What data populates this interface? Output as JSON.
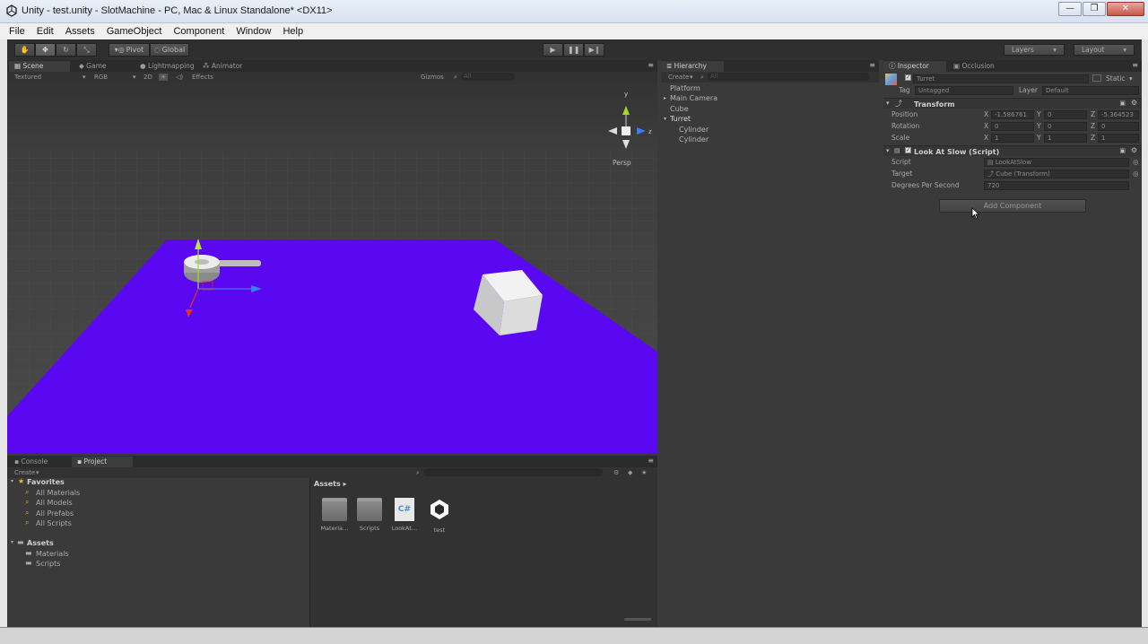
{
  "window": {
    "title": "Unity - test.unity - SlotMachine - PC, Mac & Linux Standalone* <DX11>",
    "controls": [
      "—",
      "❐",
      "✕"
    ]
  },
  "menu": [
    "File",
    "Edit",
    "Assets",
    "GameObject",
    "Component",
    "Window",
    "Help"
  ],
  "toolbar": {
    "pivot": "Pivot",
    "global": "Global",
    "layers": "Layers",
    "layout": "Layout"
  },
  "scene": {
    "tabs": [
      "Scene",
      "Game",
      "Lightmapping",
      "Animator"
    ],
    "shading": "Textured",
    "render_mode": "RGB",
    "mode_2d": "2D",
    "effects": "Effects",
    "gizmos": "Gizmos",
    "search_placeholder": "All",
    "persp_label": "Persp",
    "colors": {
      "floor": "#5b08f2",
      "sky": "#3b3b3b"
    }
  },
  "hierarchy": {
    "tab": "Hierarchy",
    "create": "Create",
    "search_placeholder": "All",
    "items": [
      "Platform",
      "Main Camera",
      "Cube",
      "Turret",
      "Cylinder",
      "Cylinder"
    ]
  },
  "inspector": {
    "tabs": [
      "Inspector",
      "Occlusion"
    ],
    "object_name": "Turret",
    "static_label": "Static",
    "tag_label": "Tag",
    "tag_value": "Untagged",
    "layer_label": "Layer",
    "layer_value": "Default",
    "transform": {
      "title": "Transform",
      "position_label": "Position",
      "rotation_label": "Rotation",
      "scale_label": "Scale",
      "position": {
        "x": "-1.586761",
        "y": "0",
        "z": "-5.364523"
      },
      "rotation": {
        "x": "0",
        "y": "0",
        "z": "0"
      },
      "scale": {
        "x": "1",
        "y": "1",
        "z": "1"
      }
    },
    "script": {
      "title": "Look At Slow (Script)",
      "script_label": "Script",
      "script_value": "LookAtSlow",
      "target_label": "Target",
      "target_value": "Cube (Transform)",
      "dps_label": "Degrees Per Second",
      "dps_value": "720"
    },
    "add_component": "Add Component"
  },
  "project": {
    "tabs": [
      "Console",
      "Project"
    ],
    "create": "Create",
    "favorites_label": "Favorites",
    "favorites": [
      "All Materials",
      "All Models",
      "All Prefabs",
      "All Scripts"
    ],
    "assets_label": "Assets",
    "folders": [
      "Materials",
      "Scripts"
    ],
    "breadcrumb": "Assets ▸",
    "asset_items": [
      {
        "name": "Materia…",
        "icon": "folder-icon"
      },
      {
        "name": "Scripts",
        "icon": "folder-icon"
      },
      {
        "name": "LookAt…",
        "icon": "csharp-script-icon"
      },
      {
        "name": "test",
        "icon": "unity-scene-icon"
      }
    ]
  }
}
